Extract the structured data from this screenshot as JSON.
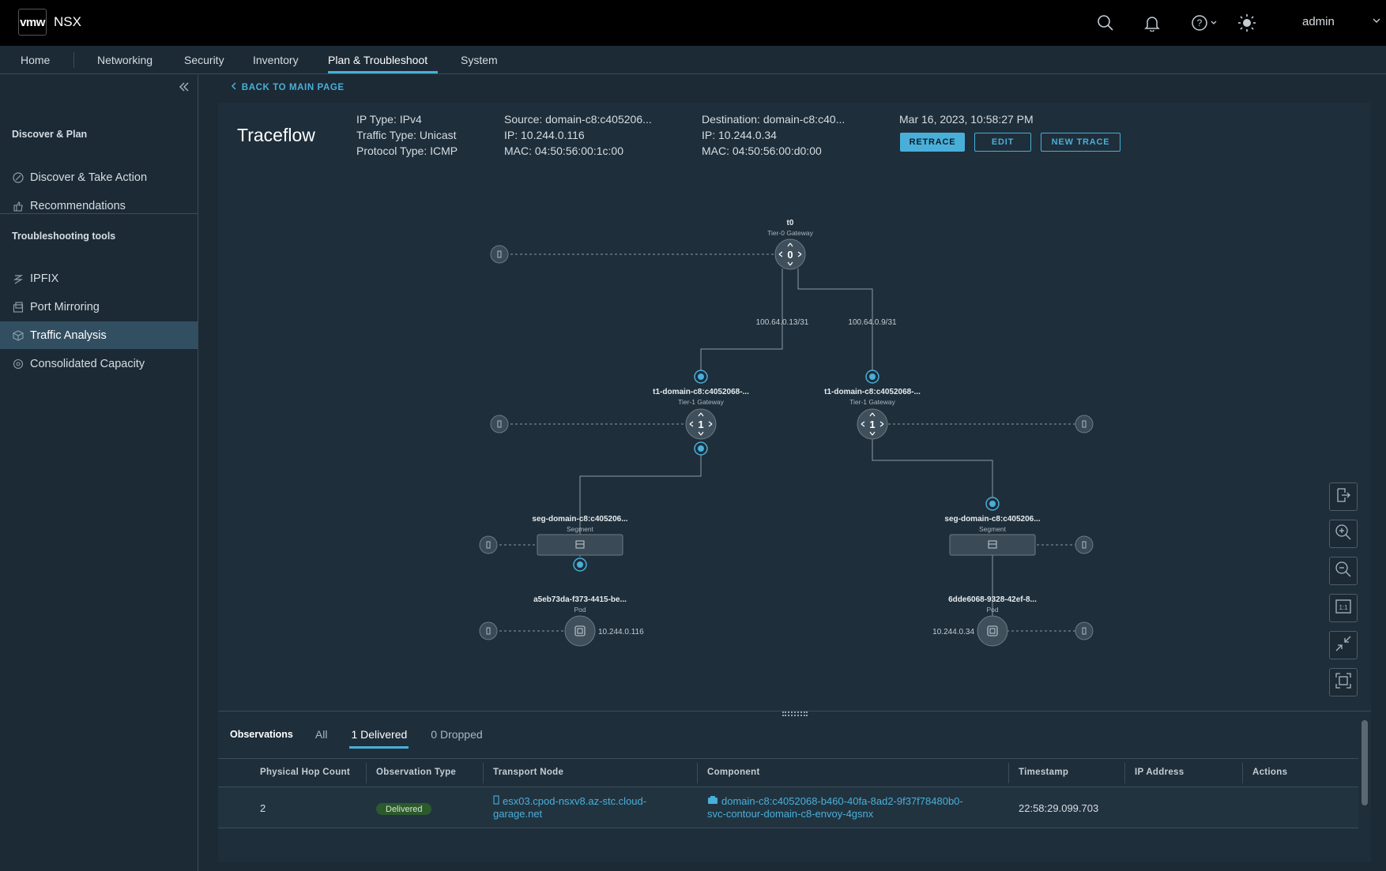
{
  "header": {
    "logo": "vmw",
    "app_name": "NSX",
    "user": "admin",
    "icons": [
      "search-icon",
      "bell-icon",
      "help-icon",
      "theme-sun-icon"
    ]
  },
  "nav": {
    "home": "Home",
    "networking": "Networking",
    "security": "Security",
    "inventory": "Inventory",
    "plan": "Plan & Troubleshoot",
    "system": "System",
    "active": "Plan & Troubleshoot"
  },
  "sidebar": {
    "section1": "Discover & Plan",
    "discover": "Discover & Take Action",
    "recommendations": "Recommendations",
    "section2": "Troubleshooting tools",
    "ipfix": "IPFIX",
    "port_mirroring": "Port Mirroring",
    "traffic_analysis": "Traffic Analysis",
    "capacity": "Consolidated Capacity",
    "active": "Traffic Analysis"
  },
  "page": {
    "back": "BACK TO MAIN PAGE",
    "title": "Traceflow",
    "ip_type": "IP Type: IPv4",
    "traffic_type": "Traffic Type: Unicast",
    "protocol_type": "Protocol Type: ICMP",
    "source": "Source: domain-c8:c405206...",
    "source_ip": "IP: 10.244.0.116",
    "source_mac": "MAC: 04:50:56:00:1c:00",
    "dest": "Destination: domain-c8:c40...",
    "dest_ip": "IP: 10.244.0.34",
    "dest_mac": "MAC: 04:50:56:00:d0:00",
    "timestamp": "Mar 16, 2023, 10:58:27 PM",
    "retrace": "RETRACE",
    "edit": "EDIT",
    "new_trace": "NEW TRACE"
  },
  "topology": {
    "t0_name": "t0",
    "t0_type": "Tier-0 Gateway",
    "link_left": "100.64.0.13/31",
    "link_right": "100.64.0.9/31",
    "t1_left_name": "t1-domain-c8:c4052068-...",
    "t1_left_type": "Tier-1 Gateway",
    "t1_right_name": "t1-domain-c8:c4052068-...",
    "t1_right_type": "Tier-1 Gateway",
    "seg_left_name": "seg-domain-c8:c405206...",
    "seg_left_type": "Segment",
    "seg_right_name": "seg-domain-c8:c405206...",
    "seg_right_type": "Segment",
    "pod_left_name": "a5eb73da-f373-4415-be...",
    "pod_left_type": "Pod",
    "pod_left_ip": "10.244.0.116",
    "pod_right_name": "6dde6068-9328-42ef-8...",
    "pod_right_type": "Pod",
    "pod_right_ip": "10.244.0.34"
  },
  "tools": [
    "export-icon",
    "zoom-in-icon",
    "zoom-out-icon",
    "actual-size-icon",
    "collapse-icon",
    "fit-icon"
  ],
  "observations": {
    "label": "Observations",
    "tab_all": "All",
    "tab_delivered": "1 Delivered",
    "tab_dropped": "0 Dropped",
    "columns": [
      "Physical Hop Count",
      "Observation Type",
      "Transport Node",
      "Component",
      "Timestamp",
      "IP Address",
      "Actions"
    ],
    "rows": [
      {
        "hop": "2",
        "type": "Delivered",
        "node_l1": "esx03.cpod-nsxv8.az-stc.cloud-",
        "node_l2": "garage.net",
        "comp_l1": "domain-c8:c4052068-b460-40fa-8ad2-9f37f78480b0-",
        "comp_l2": "svc-contour-domain-c8-envoy-4gsnx",
        "timestamp": "22:58:29.099.703",
        "ip": "",
        "actions": ""
      }
    ]
  },
  "colors": {
    "accent": "#49afd9",
    "background": "#1b2a35",
    "topbar": "#000000",
    "delivered": "#2d5a2d"
  }
}
